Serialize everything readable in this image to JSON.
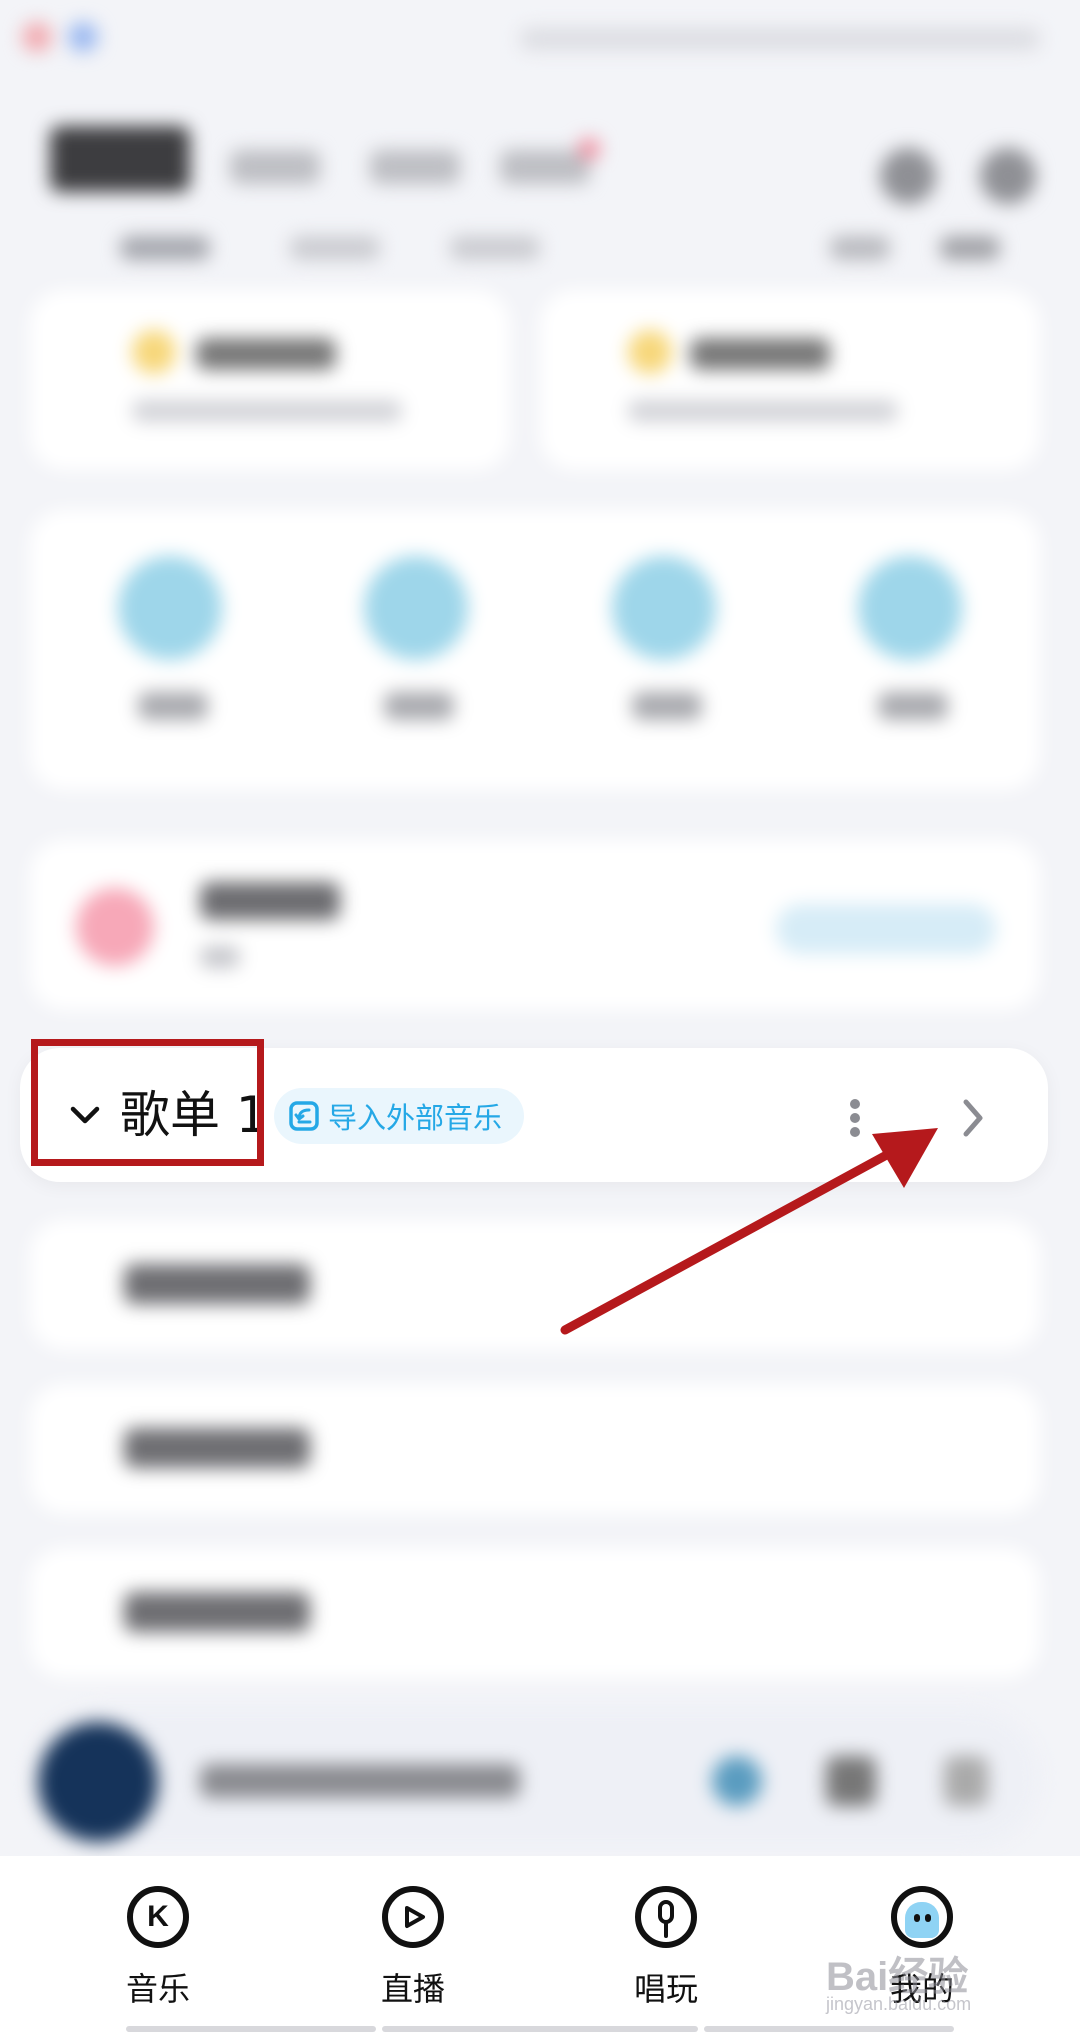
{
  "playlist": {
    "title": "歌单 1",
    "import_label": "导入外部音乐"
  },
  "bottom_nav": [
    {
      "label": "音乐",
      "icon": "k-icon"
    },
    {
      "label": "直播",
      "icon": "play-bubble-icon"
    },
    {
      "label": "唱玩",
      "icon": "microphone-icon"
    },
    {
      "label": "我的",
      "icon": "ghost-face-icon"
    }
  ],
  "watermark": {
    "text": "Bai经验",
    "sub": "jingyan.baidu.com"
  },
  "colors": {
    "accent": "#25a8e6",
    "annotation": "#b5191c",
    "text": "#111111"
  }
}
